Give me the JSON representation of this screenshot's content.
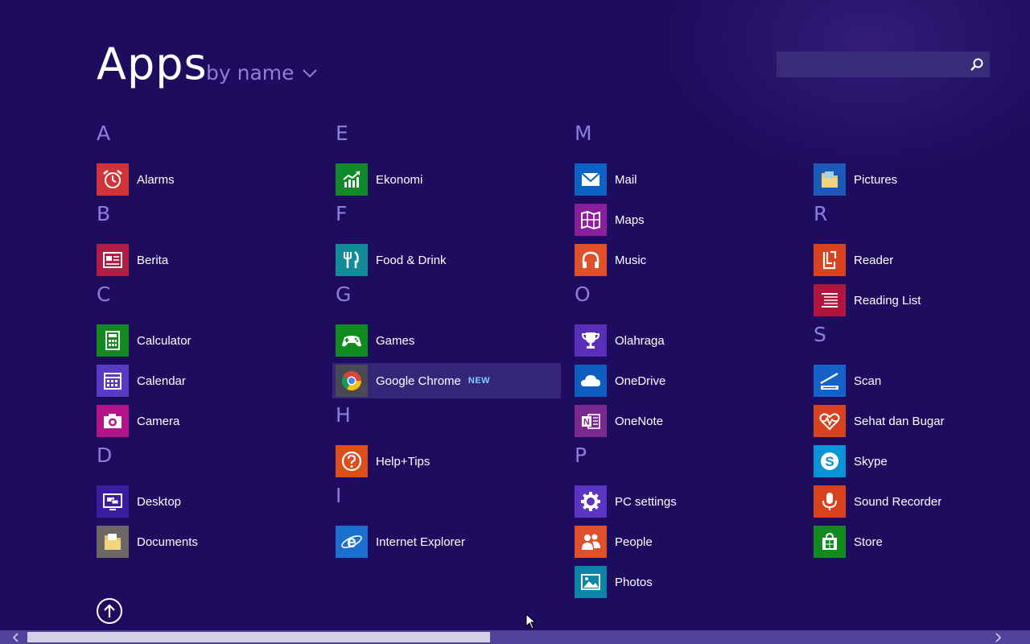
{
  "header": {
    "title": "Apps",
    "sort_label": "by name",
    "search_placeholder": ""
  },
  "columns": [
    [
      {
        "letter": "A"
      },
      {
        "app": "Alarms",
        "color": "#d13438",
        "icon": "alarm-clock-icon"
      },
      {
        "letter": "B"
      },
      {
        "app": "Berita",
        "color": "#b01e44",
        "icon": "newspaper-icon"
      },
      {
        "letter": "C"
      },
      {
        "app": "Calculator",
        "color": "#128a20",
        "icon": "calculator-icon"
      },
      {
        "app": "Calendar",
        "color": "#5a3bc4",
        "icon": "calendar-icon"
      },
      {
        "app": "Camera",
        "color": "#b4148a",
        "icon": "camera-icon"
      },
      {
        "letter": "D"
      },
      {
        "app": "Desktop",
        "color": "#3a1ea0",
        "icon": "desktop-icon"
      },
      {
        "app": "Documents",
        "color": "#6c6866",
        "icon": "documents-folder-icon"
      }
    ],
    [
      {
        "letter": "E"
      },
      {
        "app": "Ekonomi",
        "color": "#138a2a",
        "icon": "chart-up-icon"
      },
      {
        "letter": "F"
      },
      {
        "app": "Food & Drink",
        "color": "#118c98",
        "icon": "fork-knife-icon"
      },
      {
        "letter": "G"
      },
      {
        "app": "Games",
        "color": "#118c1f",
        "icon": "gamepad-icon"
      },
      {
        "app": "Google Chrome",
        "color": "#4a4a55",
        "icon": "chrome-icon",
        "badge": "NEW",
        "selected": true
      },
      {
        "letter": "H"
      },
      {
        "app": "Help+Tips",
        "color": "#dd4e1c",
        "icon": "help-icon"
      },
      {
        "letter": "I"
      },
      {
        "app": "Internet Explorer",
        "color": "#1a6fd0",
        "icon": "internet-explorer-icon"
      }
    ],
    [
      {
        "letter": "M"
      },
      {
        "app": "Mail",
        "color": "#0a63c4",
        "icon": "mail-icon"
      },
      {
        "app": "Maps",
        "color": "#8a1e9c",
        "icon": "map-icon"
      },
      {
        "app": "Music",
        "color": "#e0502a",
        "icon": "headphones-icon"
      },
      {
        "letter": "O"
      },
      {
        "app": "Olahraga",
        "color": "#5a2fb8",
        "icon": "trophy-icon"
      },
      {
        "app": "OneDrive",
        "color": "#0d5ec0",
        "icon": "cloud-icon"
      },
      {
        "app": "OneNote",
        "color": "#7a2a8e",
        "icon": "onenote-icon"
      },
      {
        "letter": "P"
      },
      {
        "app": "PC settings",
        "color": "#5b34c4",
        "icon": "gear-icon"
      },
      {
        "app": "People",
        "color": "#e0502a",
        "icon": "people-icon"
      },
      {
        "app": "Photos",
        "color": "#0a84a8",
        "icon": "photo-icon"
      }
    ],
    [
      {
        "spacer": true
      },
      {
        "app": "Pictures",
        "color": "#1a5ab8",
        "icon": "pictures-folder-icon"
      },
      {
        "letter": "R"
      },
      {
        "app": "Reader",
        "color": "#d8421e",
        "icon": "reader-icon"
      },
      {
        "app": "Reading List",
        "color": "#b0163c",
        "icon": "reading-list-icon"
      },
      {
        "letter": "S"
      },
      {
        "app": "Scan",
        "color": "#1462c8",
        "icon": "scanner-icon"
      },
      {
        "app": "Sehat dan Bugar",
        "color": "#d8421e",
        "icon": "heart-pulse-icon"
      },
      {
        "app": "Skype",
        "color": "#0a94d8",
        "icon": "skype-icon"
      },
      {
        "app": "Sound Recorder",
        "color": "#d8421e",
        "icon": "microphone-icon"
      },
      {
        "app": "Store",
        "color": "#128a20",
        "icon": "store-icon"
      }
    ]
  ],
  "footer": {
    "scroll_position": 0.45
  }
}
